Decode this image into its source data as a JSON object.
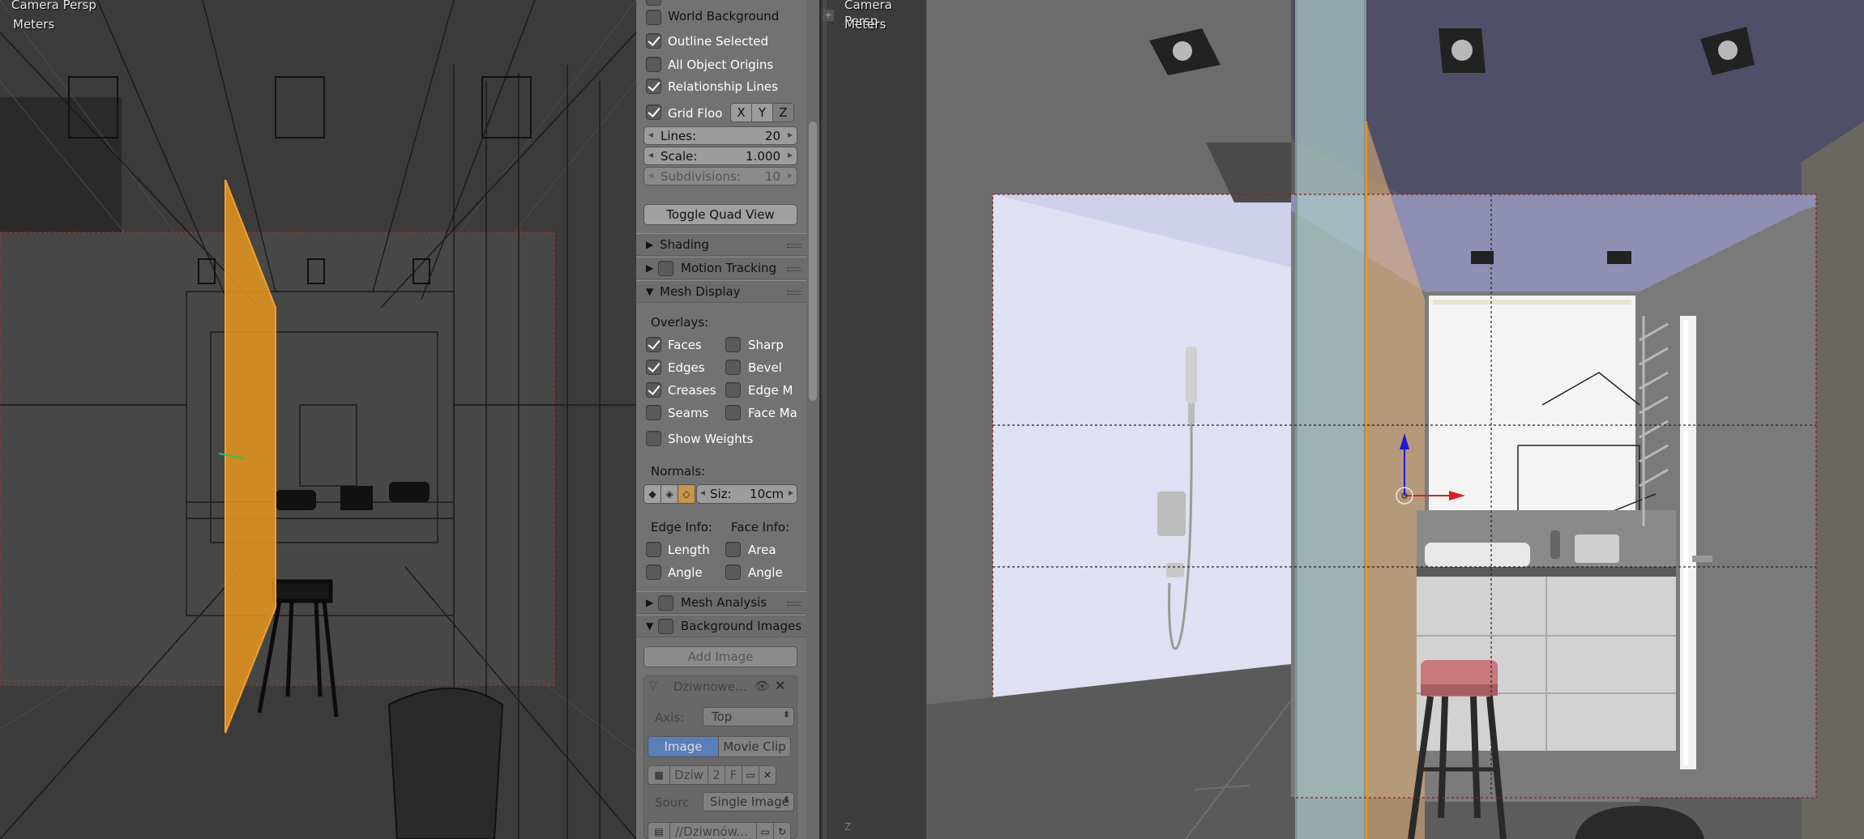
{
  "left_viewport": {
    "view_name": "Camera Persp",
    "units": "Meters"
  },
  "right_viewport": {
    "view_name": "Camera Persp",
    "units": "Meters",
    "axis_label": "Z"
  },
  "properties": {
    "world_background": {
      "label": "World Background",
      "checked": false
    },
    "outline_selected": {
      "label": "Outline Selected",
      "checked": true
    },
    "all_object_origins": {
      "label": "All Object Origins",
      "checked": false
    },
    "relationship_lines": {
      "label": "Relationship Lines",
      "checked": true
    },
    "grid_floor": {
      "label": "Grid Floo",
      "checked": true,
      "axes": [
        "X",
        "Y",
        "Z"
      ]
    },
    "lines": {
      "label": "Lines:",
      "value": "20"
    },
    "scale": {
      "label": "Scale:",
      "value": "1.000"
    },
    "subdivisions": {
      "label": "Subdivisions:",
      "value": "10"
    },
    "toggle_quad_view": "Toggle Quad View",
    "panels": {
      "shading": "Shading",
      "motion_tracking": "Motion Tracking",
      "mesh_display": "Mesh Display",
      "mesh_analysis": "Mesh Analysis",
      "background_images": "Background Images"
    },
    "overlays": {
      "title": "Overlays:",
      "items": [
        {
          "label": "Faces",
          "checked": true
        },
        {
          "label": "Sharp",
          "checked": false
        },
        {
          "label": "Edges",
          "checked": true
        },
        {
          "label": "Bevel",
          "checked": false
        },
        {
          "label": "Creases",
          "checked": true
        },
        {
          "label": "Edge M",
          "checked": false
        },
        {
          "label": "Seams",
          "checked": false
        },
        {
          "label": "Face Ma",
          "checked": false
        }
      ],
      "show_weights": {
        "label": "Show Weights",
        "checked": false
      }
    },
    "normals": {
      "title": "Normals:",
      "size_label": "Siz:",
      "size_value": "10cm"
    },
    "edge_info": {
      "title": "Edge Info:",
      "length": "Length",
      "angle": "Angle"
    },
    "face_info": {
      "title": "Face Info:",
      "area": "Area",
      "angle": "Angle"
    },
    "add_image": "Add Image",
    "bg_image": {
      "name": "Dziwnowe...",
      "axis_label": "Axis:",
      "axis_value": "Top",
      "tab_image": "Image",
      "tab_movie_clip": "Movie Clip",
      "image_short": "Dziw",
      "users": "2",
      "fake": "F",
      "source_label": "Sourc",
      "source_value": "Single Image",
      "path": "//Dziwnów..."
    }
  },
  "colors": {
    "accent_orange": "#e8961e",
    "selection_blue": "#5a7fb8",
    "panel_bg": "#727272"
  }
}
